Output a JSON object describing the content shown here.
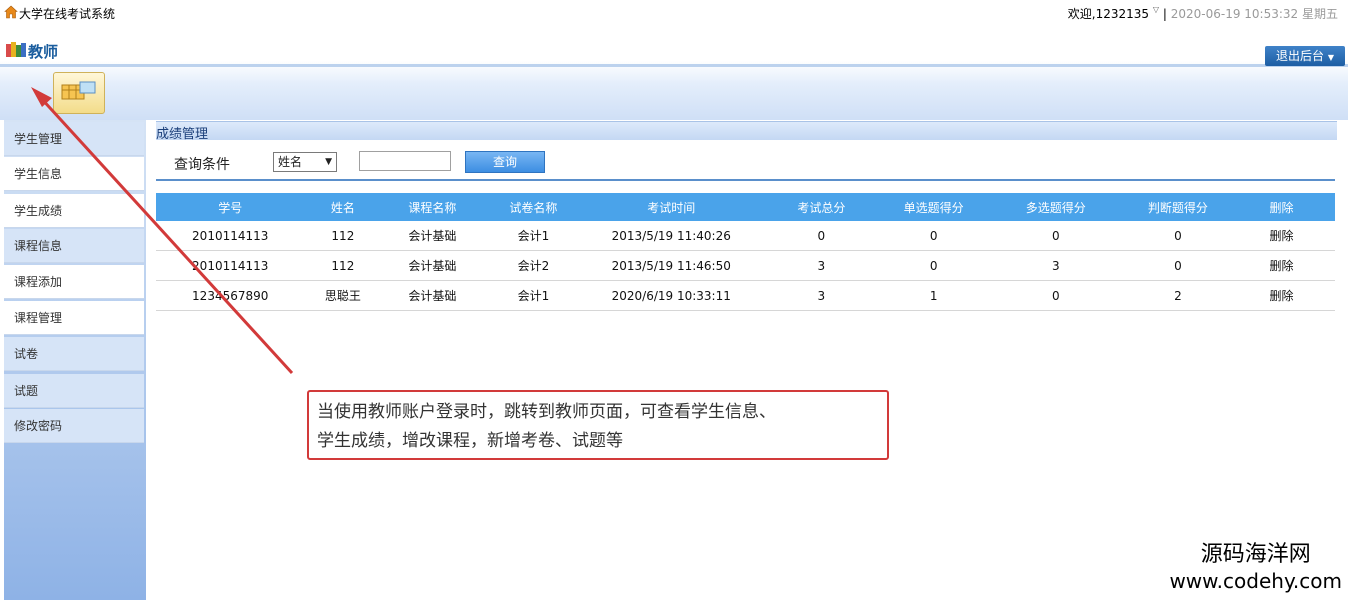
{
  "app": {
    "title": "大学在线考试系统",
    "welcome": "欢迎,1232135",
    "separator": "|",
    "datetime": "2020-06-19 10:53:32 星期五"
  },
  "header": {
    "role_title": "教师",
    "logout_label": "退出后台"
  },
  "sidebar": {
    "items": [
      {
        "label": "学生管理"
      },
      {
        "label": "学生信息"
      },
      {
        "label": "学生成绩"
      },
      {
        "label": "课程信息"
      },
      {
        "label": "课程添加"
      },
      {
        "label": "课程管理"
      },
      {
        "label": "试卷"
      },
      {
        "label": "试题"
      },
      {
        "label": "修改密码"
      }
    ]
  },
  "main": {
    "panel_title": "成绩管理",
    "query_label": "查询条件",
    "select_value": "姓名",
    "input_value": "",
    "query_button": "查询",
    "columns": [
      "学号",
      "姓名",
      "课程名称",
      "试卷名称",
      "考试时间",
      "考试总分",
      "单选题得分",
      "多选题得分",
      "判断题得分",
      "删除"
    ],
    "rows": [
      [
        "2010114113",
        "112",
        "会计基础",
        "会计1",
        "2013/5/19 11:40:26",
        "0",
        "0",
        "0",
        "0",
        "删除"
      ],
      [
        "2010114113",
        "112",
        "会计基础",
        "会计2",
        "2013/5/19 11:46:50",
        "3",
        "0",
        "3",
        "0",
        "删除"
      ],
      [
        "1234567890",
        "思聪王",
        "会计基础",
        "会计1",
        "2020/6/19 10:33:11",
        "3",
        "1",
        "0",
        "2",
        "删除"
      ]
    ]
  },
  "annotation": {
    "line1": "当使用教师账户登录时，跳转到教师页面，可查看学生信息、",
    "line2": "学生成绩，增改课程，新增考卷、试题等",
    "color": "#d23a3a"
  },
  "watermark": {
    "name": "源码海洋网",
    "url": "www.codehy.com"
  }
}
